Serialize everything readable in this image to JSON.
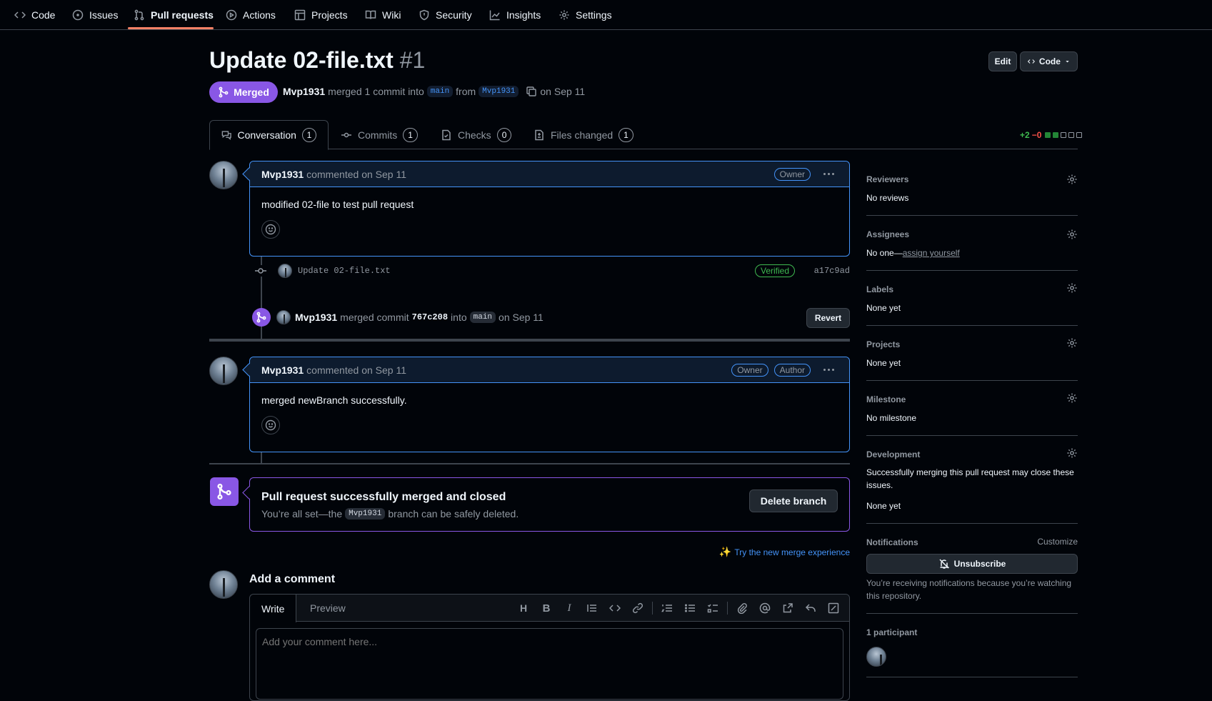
{
  "nav": {
    "items": [
      {
        "label": "Code",
        "icon": "code-icon"
      },
      {
        "label": "Issues",
        "icon": "issue-opened-icon"
      },
      {
        "label": "Pull requests",
        "icon": "git-pull-request-icon"
      },
      {
        "label": "Actions",
        "icon": "play-icon"
      },
      {
        "label": "Projects",
        "icon": "table-icon"
      },
      {
        "label": "Wiki",
        "icon": "book-icon"
      },
      {
        "label": "Security",
        "icon": "shield-icon"
      },
      {
        "label": "Insights",
        "icon": "graph-icon"
      },
      {
        "label": "Settings",
        "icon": "gear-icon"
      }
    ]
  },
  "header": {
    "title": "Update 02-file.txt",
    "number": "#1",
    "edit_label": "Edit",
    "code_label": "Code",
    "state": "Merged",
    "author": "Mvp1931",
    "merged_text": "merged 1 commit into",
    "base_branch": "main",
    "from_text": "from",
    "head_branch": "Mvp1931",
    "date_text": "on Sep 11"
  },
  "tabs": [
    {
      "label": "Conversation",
      "count": "1"
    },
    {
      "label": "Commits",
      "count": "1"
    },
    {
      "label": "Checks",
      "count": "0"
    },
    {
      "label": "Files changed",
      "count": "1"
    }
  ],
  "diffstat": {
    "additions": "+2",
    "deletions": "−0"
  },
  "timeline": {
    "comment1": {
      "author": "Mvp1931",
      "action": "commented on Sep 11",
      "badges": [
        "Owner"
      ],
      "body": "modified 02-file to test pull request"
    },
    "commit": {
      "message": "Update 02-file.txt",
      "verified": "Verified",
      "sha": "a17c9ad"
    },
    "merge_event": {
      "author": "Mvp1931",
      "text1": "merged commit",
      "sha": "767c208",
      "text2": "into",
      "branch": "main",
      "date": "on Sep 11",
      "revert_label": "Revert"
    },
    "comment2": {
      "author": "Mvp1931",
      "action": "commented on Sep 11",
      "badges": [
        "Owner",
        "Author"
      ],
      "body": "merged newBranch successfully."
    },
    "merged_box": {
      "title": "Pull request successfully merged and closed",
      "text_before": "You’re all set—the",
      "branch": "Mvp1931",
      "text_after": "branch can be safely deleted.",
      "delete_label": "Delete branch"
    },
    "try_new": "Try the new merge experience"
  },
  "comment_form": {
    "title": "Add a comment",
    "write_tab": "Write",
    "preview_tab": "Preview",
    "placeholder": "Add your comment here...",
    "tools": [
      "heading-icon",
      "bold-icon",
      "italic-icon",
      "quote-icon",
      "code-icon",
      "link-icon",
      "ordered-list-icon",
      "unordered-list-icon",
      "task-list-icon",
      "paperclip-icon",
      "mention-icon",
      "cross-reference-icon",
      "reply-icon",
      "fullscreen-icon"
    ]
  },
  "sidebar": {
    "reviewers": {
      "label": "Reviewers",
      "value": "No reviews"
    },
    "assignees": {
      "label": "Assignees",
      "value_prefix": "No one—",
      "link": "assign yourself"
    },
    "labels": {
      "label": "Labels",
      "value": "None yet"
    },
    "projects": {
      "label": "Projects",
      "value": "None yet"
    },
    "milestone": {
      "label": "Milestone",
      "value": "No milestone"
    },
    "development": {
      "label": "Development",
      "desc": "Successfully merging this pull request may close these issues.",
      "value": "None yet"
    },
    "notifications": {
      "label": "Notifications",
      "customize": "Customize",
      "button": "Unsubscribe",
      "desc": "You’re receiving notifications because you’re watching this repository."
    },
    "participants": {
      "label": "1 participant"
    }
  },
  "colors": {
    "accent": "#4493f8",
    "merged": "#8957e5",
    "success": "#3fb950",
    "danger": "#f85149"
  }
}
